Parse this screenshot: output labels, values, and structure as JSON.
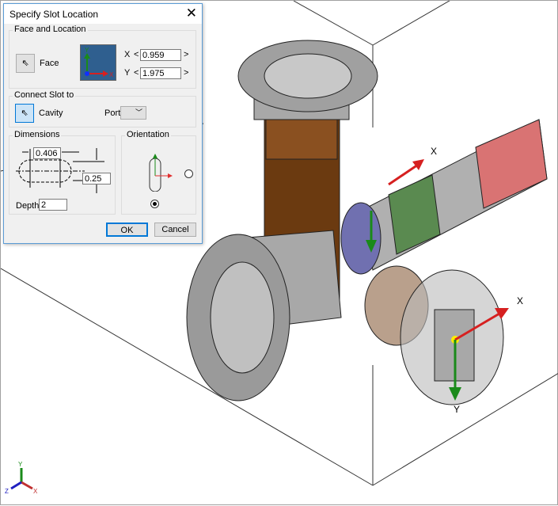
{
  "dialog": {
    "title": "Specify Slot Location",
    "face_location": {
      "label": "Face and Location",
      "face_button": "Face",
      "x_label": "X",
      "y_label": "Y",
      "x_value": "0.959",
      "y_value": "1.975",
      "preview_x": "X",
      "preview_y": "Y",
      "dec": "<",
      "inc": ">"
    },
    "connect": {
      "label": "Connect Slot to",
      "cavity_button": "Cavity",
      "port_label": "Port",
      "port_value": ""
    },
    "dimensions": {
      "label": "Dimensions",
      "width": "0.406",
      "height": "0.25",
      "depth_label": "Depth",
      "depth": "2"
    },
    "orientation": {
      "label": "Orientation",
      "selected": "vertical"
    },
    "ok": "OK",
    "cancel": "Cancel"
  },
  "viewport": {
    "axis_labels": {
      "x": "X",
      "y": "Y",
      "z": "Z"
    },
    "port1_x": "X",
    "port2_x": "X",
    "port2_y": "Y"
  },
  "colors": {
    "accent": "#0078d7",
    "preview_bg": "#2f5f8f",
    "red": "#d62020",
    "green": "#1a8a1a",
    "blue": "#2020d0"
  }
}
